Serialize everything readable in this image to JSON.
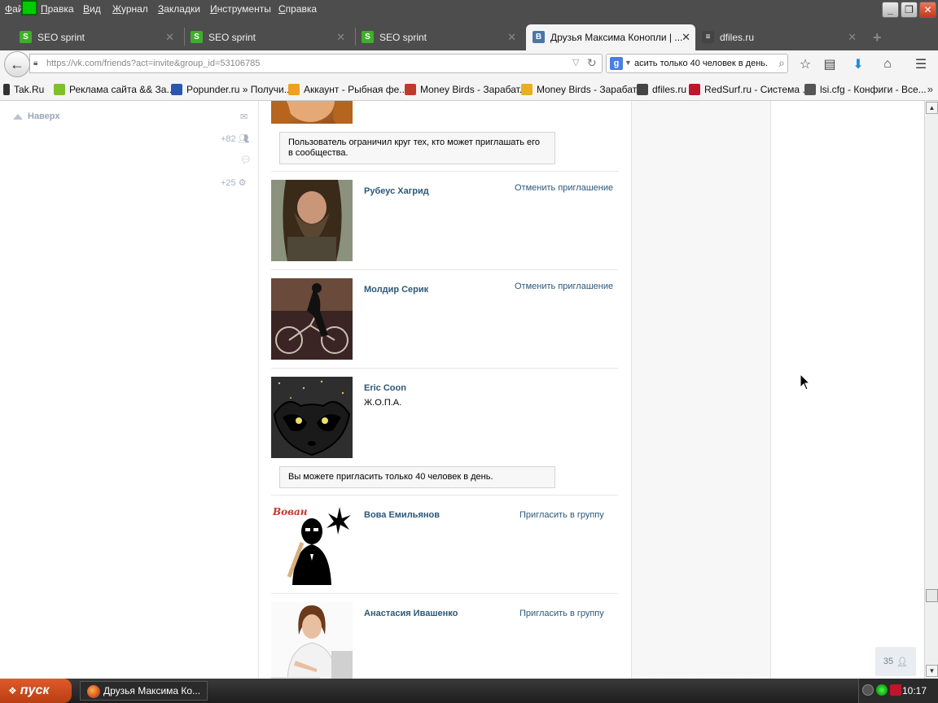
{
  "menu": [
    "Файл",
    "Правка",
    "Вид",
    "Журнал",
    "Закладки",
    "Инструменты",
    "Справка"
  ],
  "tabs": [
    {
      "title": "SEO sprint",
      "icon": "S",
      "color": "#3fae2a"
    },
    {
      "title": "SEO sprint",
      "icon": "S",
      "color": "#3fae2a"
    },
    {
      "title": "SEO sprint",
      "icon": "S",
      "color": "#3fae2a"
    },
    {
      "title": "Друзья Максима Конопли | ...",
      "icon": "B",
      "color": "#4a76a8"
    },
    {
      "title": "dfiles.ru",
      "icon": "≡",
      "color": "#444444"
    }
  ],
  "url": "https://vk.com/friends?act=invite&group_id=53106785",
  "search_value": "асить только 40 человек в день.",
  "bookmarks": [
    {
      "label": "Tak.Ru",
      "color": "#333333"
    },
    {
      "label": "Реклама сайта && За...",
      "color": "#7fbf2a"
    },
    {
      "label": "Popunder.ru » Получи...",
      "color": "#2a56b0"
    },
    {
      "label": "Аккаунт - Рыбная фе...",
      "color": "#f0a020"
    },
    {
      "label": "Money Birds - Зарабат...",
      "color": "#c0392b"
    },
    {
      "label": "Money Birds - Зарабат...",
      "color": "#e8b020"
    },
    {
      "label": "dfiles.ru",
      "color": "#444444"
    },
    {
      "label": "RedSurf.ru - Система ...",
      "color": "#c0152a"
    },
    {
      "label": "lsi.cfg - Конфиги - Все...",
      "color": "#555555"
    }
  ],
  "left_nav": {
    "up_label": "Наверх",
    "friends_count": "+82",
    "settings_count": "+25"
  },
  "notices": {
    "restricted": "Пользователь ограничил круг тех, кто может приглашать его в сообщества.",
    "limit": "Вы можете пригласить только 40 человек в день."
  },
  "people": [
    {
      "name": "Рубеус Хагрид",
      "action": "Отменить приглашение",
      "sub": ""
    },
    {
      "name": "Молдир Серик",
      "action": "Отменить приглашение",
      "sub": ""
    },
    {
      "name": "Eric Coon",
      "action": "",
      "sub": "Ж.О.П.А."
    },
    {
      "name": "Вова Емильянов",
      "action": "Пригласить в группу",
      "sub": "",
      "photo_caption": "Вован"
    },
    {
      "name": "Анастасия Ивашенко",
      "action": "Пригласить в группу",
      "sub": ""
    }
  ],
  "online_count": "35",
  "taskbar": {
    "start": "пуск",
    "window": "Друзья Максима Ко...",
    "time": "10:17"
  }
}
